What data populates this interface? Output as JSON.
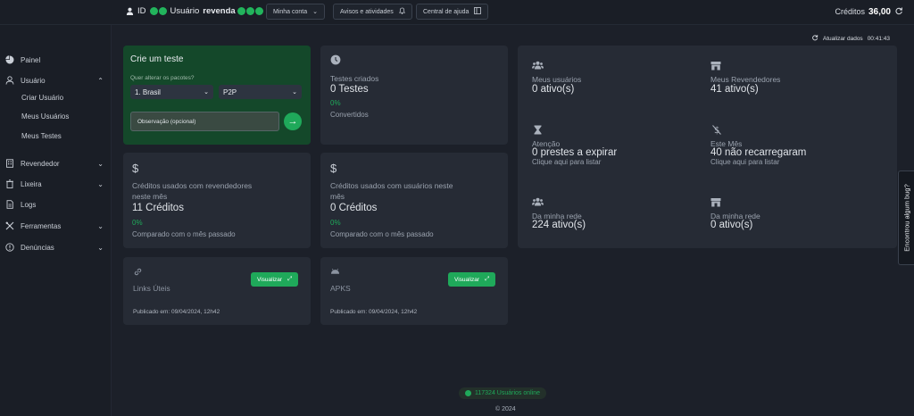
{
  "header": {
    "id_label": "ID",
    "user_label": "Usuário",
    "user_name": "revenda",
    "buttons": {
      "my_account": "Minha conta",
      "notices": "Avisos e atividades",
      "help": "Central de ajuda"
    },
    "credits_label": "Créditos",
    "credits_value": "36,00"
  },
  "sidebar": {
    "panel": "Painel",
    "user": "Usuário",
    "user_sub": [
      "Criar Usuário",
      "Meus Usuários",
      "Meus Testes"
    ],
    "reseller": "Revendedor",
    "trash": "Lixeira",
    "logs": "Logs",
    "tools": "Ferramentas",
    "reports": "Denúncias"
  },
  "refresh": {
    "label": "Atualizar dados",
    "time": "00:41:43"
  },
  "test_card": {
    "title": "Crie um teste",
    "question": "Quer alterar os pacotes?",
    "country": "1. Brasil",
    "package": "P2P",
    "observation_placeholder": "Observação (opcional)"
  },
  "tests_card": {
    "label": "Testes criados",
    "value": "0 Testes",
    "pct": "0%",
    "sub": "Convertidos"
  },
  "resellers_credits": {
    "symbol": "$",
    "line1": "Créditos usados com revendedores",
    "line2": "neste mês",
    "value": "11 Créditos",
    "pct": "0%",
    "sub": "Comparado com o mês passado"
  },
  "users_credits": {
    "symbol": "$",
    "line1": "Créditos usados com usuários neste",
    "line2": "mês",
    "value": "0 Créditos",
    "pct": "0%",
    "sub": "Comparado com o mês passado"
  },
  "links_card": {
    "title": "Links Úteis",
    "button": "Visualizar",
    "published": "Publicado em: 09/04/2024, 12h42"
  },
  "apks_card": {
    "title": "APKS",
    "button": "Visualizar",
    "published": "Publicado em: 09/04/2024, 12h42"
  },
  "stats": {
    "my_users": {
      "label": "Meus usuários",
      "value": "0 ativo(s)"
    },
    "my_resellers": {
      "label": "Meus Revendedores",
      "value": "41 ativo(s)"
    },
    "attention": {
      "label": "Atenção",
      "value": "0 prestes a expirar",
      "sub": "Clique aqui para listar"
    },
    "this_month": {
      "label": "Este Mês",
      "value": "40 não recarregaram",
      "sub": "Clique aqui para listar"
    },
    "network_users": {
      "label": "Da minha rede",
      "value": "224 ativo(s)"
    },
    "network_resellers": {
      "label": "Da minha rede",
      "value": "0 ativo(s)"
    }
  },
  "bug_tab": "Encontrou algum bug?",
  "footer": {
    "online": "117324 Usuários online",
    "copyright": "© 2024"
  },
  "colors": {
    "accent": "#1fa95a",
    "background": "#1c2029",
    "card": "#262b35",
    "green_card": "#14482a"
  }
}
